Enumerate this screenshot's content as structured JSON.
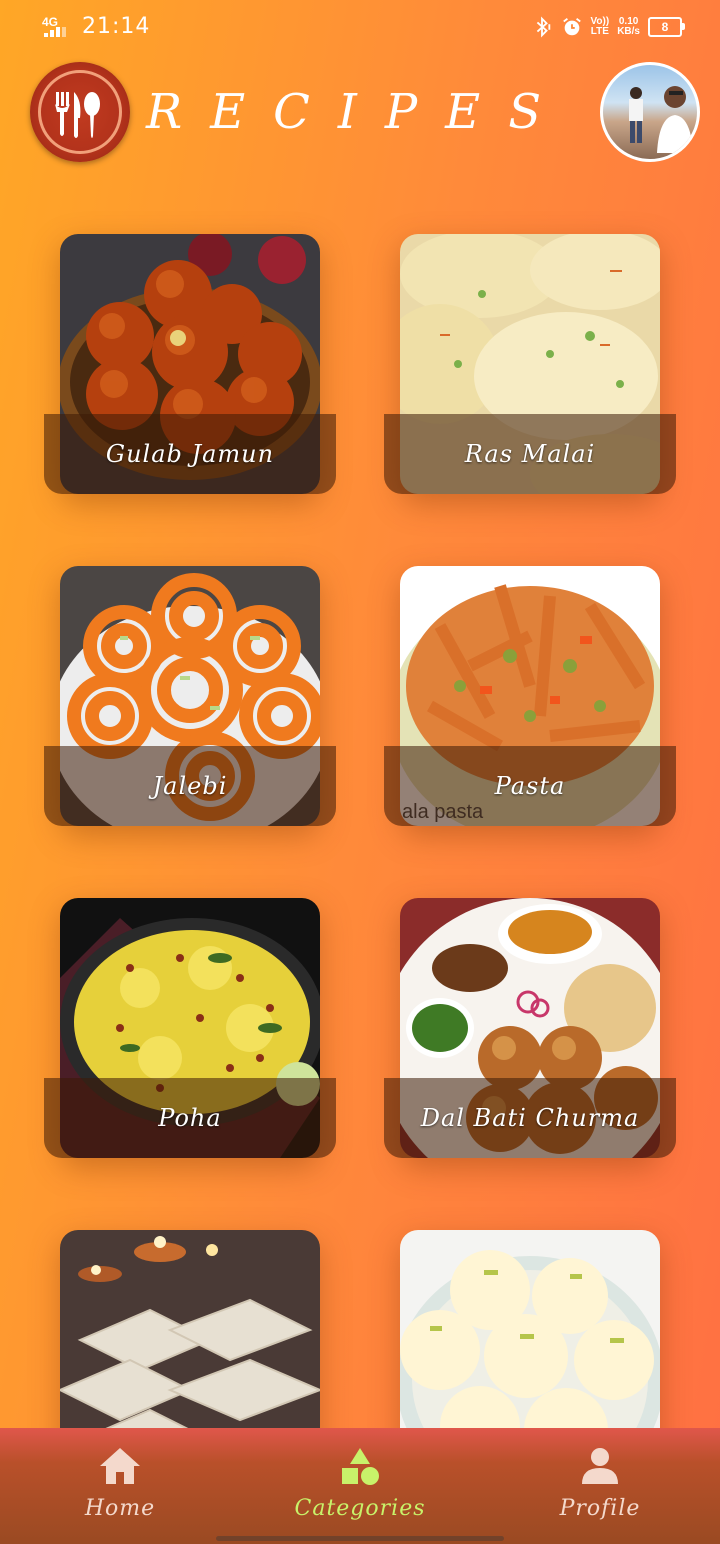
{
  "status_bar": {
    "network": "4G",
    "time": "21:14",
    "volte_line1": "Vo))",
    "volte_line2": "LTE",
    "speed_value": "0.10",
    "speed_unit": "KB/s",
    "battery": "8"
  },
  "header": {
    "title": "RECIPES"
  },
  "recipes": [
    {
      "name": "Gulab Jamun"
    },
    {
      "name": "Ras Malai"
    },
    {
      "name": "Jalebi"
    },
    {
      "name": "Pasta"
    },
    {
      "name": "Poha"
    },
    {
      "name": "Dal Bati Churma"
    }
  ],
  "bottom_nav": {
    "home": "Home",
    "categories": "Categories",
    "profile": "Profile",
    "active": "categories",
    "active_color": "#C8F26A"
  }
}
